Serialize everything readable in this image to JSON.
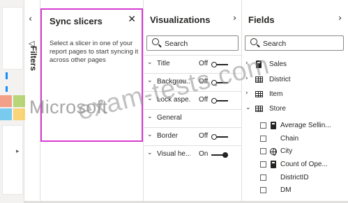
{
  "colors": {
    "highlight_border": "#d63bd1",
    "accent_blue": "#118dff",
    "text": "#252423",
    "pane_border": "#e1dfdd",
    "ms_red": "#f25022",
    "ms_green": "#7fba00",
    "ms_blue": "#00a4ef",
    "ms_yellow": "#ffb900"
  },
  "filters": {
    "label": "Filters",
    "collapse_icon": "chevron-left-icon",
    "filter_icon": "funnel-icon",
    "canvas_scroll_icon": "caret-right-icon"
  },
  "sync_slicers": {
    "title": "Sync slicers",
    "close_icon": "close-icon",
    "description": "Select a slicer in one of your report pages to start syncing it across other pages"
  },
  "visualizations": {
    "title": "Visualizations",
    "collapse_icon": "chevron-right-icon",
    "search_placeholder": "Search",
    "sections": [
      {
        "label": "Title",
        "state": "Off",
        "toggle": "off"
      },
      {
        "label": "Backgrou...",
        "state": "Off",
        "toggle": "off"
      },
      {
        "label": "Lock aspe...",
        "state": "Off",
        "toggle": "off"
      },
      {
        "label": "General",
        "state": "",
        "toggle": "none"
      },
      {
        "label": "Border",
        "state": "Off",
        "toggle": "off"
      },
      {
        "label": "Visual he...",
        "state": "On",
        "toggle": "on"
      }
    ]
  },
  "fields": {
    "title": "Fields",
    "collapse_icon": "chevron-right-icon",
    "search_placeholder": "Search",
    "tables": [
      {
        "name": "Sales",
        "icon": "calculator-icon",
        "expanded": false
      },
      {
        "name": "District",
        "icon": "table-icon",
        "expanded": false
      },
      {
        "name": "Item",
        "icon": "table-icon",
        "expanded": false
      },
      {
        "name": "Store",
        "icon": "table-icon",
        "expanded": true
      }
    ],
    "store_fields": [
      {
        "name": "Average Sellin...",
        "icon": "measure-icon"
      },
      {
        "name": "Chain",
        "icon": ""
      },
      {
        "name": "City",
        "icon": "globe-icon"
      },
      {
        "name": "Count of Ope...",
        "icon": "measure-icon"
      },
      {
        "name": "DistrictID",
        "icon": ""
      },
      {
        "name": "DM",
        "icon": ""
      }
    ]
  },
  "watermarks": {
    "microsoft": "Microsoft",
    "exam_tests": "exam-tests.com"
  }
}
